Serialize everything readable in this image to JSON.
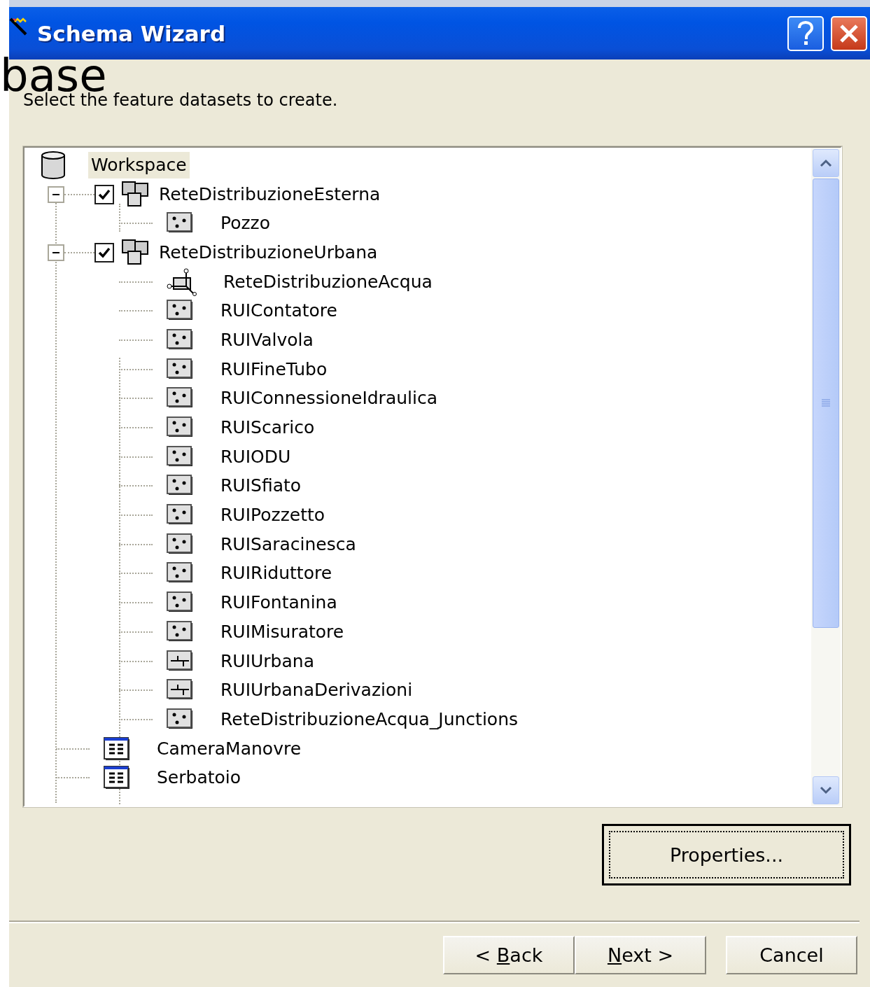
{
  "window": {
    "title": "Schema Wizard"
  },
  "overlay_text": "base",
  "instruction": "Select the feature datasets to create.",
  "tree": [
    {
      "label": "Workspace",
      "kind": "workspace",
      "selected": true,
      "children": [
        {
          "label": "ReteDistribuzioneEsterna",
          "kind": "dataset",
          "checked": true,
          "expanded": true,
          "selected": false,
          "children": [
            {
              "label": "Pozzo",
              "kind": "point",
              "selected": false
            }
          ]
        },
        {
          "label": "ReteDistribuzioneUrbana",
          "kind": "dataset",
          "checked": true,
          "expanded": true,
          "selected": false,
          "children": [
            {
              "label": "ReteDistribuzioneAcqua",
              "kind": "network",
              "selected": false
            },
            {
              "label": "RUIContatore",
              "kind": "point",
              "selected": false
            },
            {
              "label": "RUIValvola",
              "kind": "point",
              "selected": false
            },
            {
              "label": "RUIFineTubo",
              "kind": "point",
              "selected": false
            },
            {
              "label": "RUIConnessioneIdraulica",
              "kind": "point",
              "selected": false
            },
            {
              "label": "RUIScarico",
              "kind": "point",
              "selected": false
            },
            {
              "label": "RUIODU",
              "kind": "point",
              "selected": false
            },
            {
              "label": "RUISfiato",
              "kind": "point",
              "selected": false
            },
            {
              "label": "RUIPozzetto",
              "kind": "point",
              "selected": false
            },
            {
              "label": "RUISaracinesca",
              "kind": "point",
              "selected": false
            },
            {
              "label": "RUIRiduttore",
              "kind": "point",
              "selected": false
            },
            {
              "label": "RUIFontanina",
              "kind": "point",
              "selected": false
            },
            {
              "label": "RUIMisuratore",
              "kind": "point",
              "selected": false
            },
            {
              "label": "RUIUrbana",
              "kind": "line",
              "selected": false
            },
            {
              "label": "RUIUrbanaDerivazioni",
              "kind": "line",
              "selected": false
            },
            {
              "label": "ReteDistribuzioneAcqua_Junctions",
              "kind": "point",
              "selected": false
            }
          ]
        },
        {
          "label": "CameraManovre",
          "kind": "table",
          "selected": false
        },
        {
          "label": "Serbatoio",
          "kind": "table",
          "selected": false
        }
      ]
    }
  ],
  "properties_button": "Properties...",
  "nav_buttons": [
    {
      "pre": "< ",
      "key": "B",
      "post": "ack"
    },
    {
      "key": "N",
      "post": "ext >"
    }
  ],
  "cancel_button": "Cancel"
}
